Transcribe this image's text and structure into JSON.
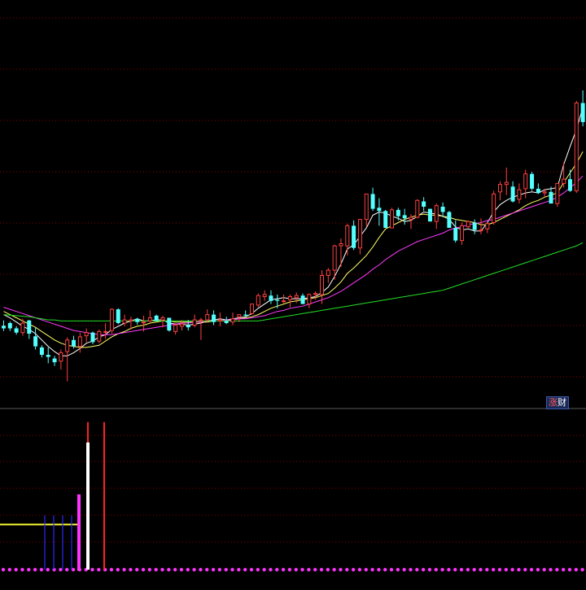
{
  "badge": {
    "text_a": "涨",
    "text_b": "财"
  },
  "colors": {
    "background": "#000000",
    "grid": "#8a0000",
    "panel_divider": "#5a5a5a",
    "up": "#ff4040",
    "down": "#54ffff",
    "ma5": "#ffffff",
    "ma10": "#ffff66",
    "ma20": "#ff3bff",
    "ma60": "#22e022",
    "indicator_line": "#ffff33",
    "indicator_dots": "#ff33ff",
    "indicator_blue": "#2a2aff",
    "indicator_red": "#ff2222",
    "indicator_magenta": "#ff33ff"
  },
  "chart_data": {
    "type": "candlestick",
    "price_range": [
      0,
      100
    ],
    "candles": [
      [
        61.5,
        62.5,
        60.5,
        61.0
      ],
      [
        62.0,
        62.3,
        60.5,
        61.0
      ],
      [
        61.0,
        61.4,
        59.8,
        60.2
      ],
      [
        60.2,
        62.8,
        59.6,
        62.0
      ],
      [
        62.5,
        62.6,
        59.0,
        60.0
      ],
      [
        59.5,
        61.2,
        57.0,
        57.6
      ],
      [
        57.4,
        57.8,
        55.5,
        56.0
      ],
      [
        56.0,
        57.4,
        54.4,
        55.6
      ],
      [
        55.3,
        55.8,
        53.9,
        54.6
      ],
      [
        54.8,
        57.0,
        53.2,
        56.4
      ],
      [
        56.6,
        59.3,
        51.0,
        58.8
      ],
      [
        58.8,
        59.6,
        57.2,
        57.6
      ],
      [
        57.6,
        60.2,
        56.4,
        59.4
      ],
      [
        59.6,
        61.0,
        58.4,
        60.2
      ],
      [
        60.2,
        60.4,
        58.0,
        58.4
      ],
      [
        58.6,
        60.8,
        58.2,
        60.4
      ],
      [
        60.4,
        62.0,
        59.0,
        60.4
      ],
      [
        60.6,
        64.8,
        60.0,
        64.6
      ],
      [
        64.6,
        64.8,
        61.8,
        62.0
      ],
      [
        62.0,
        63.6,
        61.4,
        62.6
      ],
      [
        62.4,
        63.2,
        60.8,
        62.6
      ],
      [
        62.8,
        63.0,
        61.7,
        62.2
      ],
      [
        62.2,
        63.4,
        60.4,
        62.2
      ],
      [
        62.4,
        64.4,
        62.0,
        63.0
      ],
      [
        63.4,
        63.6,
        62.4,
        62.4
      ],
      [
        62.6,
        63.4,
        61.2,
        63.0
      ],
      [
        63.0,
        63.0,
        60.4,
        60.6
      ],
      [
        60.4,
        62.0,
        59.8,
        61.6
      ],
      [
        61.4,
        62.6,
        60.6,
        61.8
      ],
      [
        61.6,
        62.6,
        60.6,
        61.2
      ],
      [
        61.6,
        63.6,
        61.2,
        62.6
      ],
      [
        62.6,
        63.0,
        58.8,
        62.6
      ],
      [
        62.6,
        64.6,
        62.2,
        63.6
      ],
      [
        63.6,
        64.4,
        61.6,
        62.2
      ],
      [
        62.4,
        64.0,
        61.4,
        62.6
      ],
      [
        62.4,
        63.2,
        61.8,
        62.0
      ],
      [
        62.2,
        64.0,
        61.6,
        62.8
      ],
      [
        63.2,
        63.6,
        62.2,
        63.6
      ],
      [
        63.6,
        64.4,
        63.2,
        63.4
      ],
      [
        63.8,
        65.6,
        63.6,
        65.6
      ],
      [
        65.4,
        67.6,
        65.0,
        67.2
      ],
      [
        67.0,
        68.2,
        66.2,
        67.4
      ],
      [
        67.2,
        68.2,
        65.6,
        66.2
      ],
      [
        66.4,
        67.4,
        64.8,
        66.2
      ],
      [
        66.2,
        67.4,
        65.8,
        66.2
      ],
      [
        66.4,
        67.4,
        65.0,
        67.0
      ],
      [
        66.8,
        67.8,
        65.8,
        67.2
      ],
      [
        67.2,
        67.6,
        65.6,
        65.6
      ],
      [
        65.6,
        67.6,
        64.8,
        67.4
      ],
      [
        67.4,
        68.0,
        66.4,
        67.6
      ],
      [
        67.4,
        72.0,
        65.6,
        71.0
      ],
      [
        71.0,
        72.4,
        69.6,
        72.0
      ],
      [
        72.0,
        76.8,
        70.2,
        76.6
      ],
      [
        76.6,
        78.0,
        72.6,
        77.0
      ],
      [
        76.6,
        80.8,
        74.8,
        80.4
      ],
      [
        80.4,
        81.4,
        75.8,
        76.2
      ],
      [
        76.2,
        81.6,
        75.0,
        81.6
      ],
      [
        81.6,
        86.4,
        80.2,
        86.4
      ],
      [
        86.4,
        87.6,
        83.2,
        83.6
      ],
      [
        83.8,
        85.6,
        80.4,
        83.2
      ],
      [
        83.2,
        83.4,
        80.0,
        80.0
      ],
      [
        80.0,
        83.8,
        80.0,
        83.4
      ],
      [
        83.4,
        83.8,
        81.4,
        82.2
      ],
      [
        82.4,
        83.6,
        80.6,
        81.8
      ],
      [
        81.6,
        82.6,
        79.8,
        82.0
      ],
      [
        82.0,
        85.4,
        81.8,
        85.2
      ],
      [
        85.0,
        85.8,
        83.2,
        84.0
      ],
      [
        83.6,
        83.6,
        81.2,
        81.2
      ],
      [
        81.2,
        84.6,
        79.8,
        84.2
      ],
      [
        84.0,
        84.8,
        82.0,
        83.0
      ],
      [
        83.0,
        83.2,
        80.2,
        80.0
      ],
      [
        80.0,
        81.4,
        77.2,
        77.6
      ],
      [
        77.6,
        81.0,
        76.8,
        80.4
      ],
      [
        80.2,
        81.4,
        80.0,
        81.2
      ],
      [
        81.0,
        81.6,
        78.8,
        79.6
      ],
      [
        79.6,
        81.8,
        78.8,
        79.6
      ],
      [
        79.8,
        81.0,
        79.0,
        80.8
      ],
      [
        81.0,
        87.0,
        80.6,
        86.4
      ],
      [
        86.8,
        88.8,
        85.2,
        88.2
      ],
      [
        88.2,
        91.4,
        86.2,
        88.6
      ],
      [
        87.8,
        88.8,
        84.8,
        85.0
      ],
      [
        85.4,
        88.4,
        84.6,
        87.2
      ],
      [
        87.4,
        91.0,
        85.6,
        90.2
      ],
      [
        90.2,
        90.6,
        87.0,
        87.4
      ],
      [
        87.4,
        88.4,
        86.4,
        86.6
      ],
      [
        86.6,
        87.4,
        85.8,
        86.8
      ],
      [
        86.8,
        87.8,
        84.8,
        84.6
      ],
      [
        84.6,
        88.4,
        84.0,
        88.4
      ],
      [
        88.4,
        92.4,
        87.6,
        89.2
      ],
      [
        89.2,
        91.0,
        86.8,
        87.0
      ],
      [
        87.0,
        104.0,
        86.6,
        103.6
      ],
      [
        103.6,
        106.0,
        99.2,
        100.0
      ],
      [
        100.0,
        107.2,
        98.6,
        104.2
      ],
      [
        104.2,
        110.0,
        103.2,
        109.8
      ]
    ],
    "ma_series": [
      {
        "name": "MA5",
        "values": [
          63.6,
          63.0,
          62.2,
          61.4,
          60.8,
          60.0,
          58.8,
          57.6,
          56.6,
          55.8,
          55.8,
          56.4,
          57.2,
          58.2,
          58.6,
          59.4,
          59.8,
          60.8,
          61.4,
          62.0,
          62.4,
          62.8,
          62.4,
          62.4,
          62.6,
          62.6,
          62.0,
          61.8,
          61.8,
          61.6,
          61.8,
          62.0,
          62.4,
          62.6,
          62.8,
          62.6,
          62.8,
          63.0,
          63.2,
          63.8,
          64.8,
          65.6,
          66.4,
          66.6,
          66.8,
          66.6,
          66.6,
          66.6,
          66.8,
          67.0,
          67.8,
          68.8,
          70.8,
          73.2,
          76.0,
          76.8,
          78.4,
          80.0,
          82.4,
          83.0,
          82.8,
          82.2,
          81.8,
          81.2,
          81.4,
          82.2,
          83.0,
          82.8,
          82.6,
          82.2,
          81.6,
          80.2,
          79.6,
          79.8,
          79.4,
          79.4,
          81.0,
          83.0,
          84.4,
          85.2,
          85.8,
          86.2,
          86.6,
          86.8,
          86.6,
          87.2,
          87.4,
          87.6,
          92.0,
          95.4,
          98.6,
          102.8
        ]
      },
      {
        "name": "MA10",
        "values": [
          64.2,
          63.6,
          63.0,
          62.4,
          61.8,
          61.2,
          60.4,
          59.6,
          58.8,
          58.2,
          57.8,
          57.6,
          57.4,
          57.4,
          57.6,
          57.8,
          58.6,
          59.4,
          60.0,
          60.4,
          61.0,
          61.4,
          61.6,
          62.0,
          62.2,
          62.4,
          62.4,
          62.2,
          62.2,
          62.2,
          62.2,
          62.2,
          62.2,
          62.4,
          62.4,
          62.4,
          62.6,
          62.8,
          63.0,
          63.2,
          63.6,
          64.2,
          64.8,
          65.2,
          65.6,
          66.0,
          66.2,
          66.4,
          66.6,
          66.8,
          67.2,
          67.6,
          68.6,
          69.8,
          71.4,
          72.4,
          73.6,
          74.8,
          76.4,
          78.2,
          79.8,
          80.4,
          81.0,
          81.6,
          82.0,
          82.4,
          82.6,
          82.4,
          82.4,
          82.2,
          82.0,
          81.6,
          81.4,
          81.2,
          81.0,
          80.6,
          80.6,
          81.0,
          81.6,
          82.2,
          82.8,
          83.4,
          84.2,
          84.8,
          85.2,
          85.8,
          86.2,
          86.6,
          88.6,
          90.4,
          92.2,
          94.4
        ]
      },
      {
        "name": "MA20",
        "values": [
          65.0,
          64.6,
          64.2,
          63.8,
          63.4,
          63.0,
          62.6,
          62.2,
          61.8,
          61.4,
          61.0,
          60.6,
          60.4,
          60.2,
          60.0,
          59.8,
          59.8,
          59.8,
          60.0,
          60.2,
          60.4,
          60.6,
          60.8,
          61.0,
          61.2,
          61.4,
          61.6,
          61.8,
          62.0,
          62.0,
          62.2,
          62.2,
          62.4,
          62.4,
          62.4,
          62.6,
          62.6,
          62.8,
          62.8,
          63.0,
          63.2,
          63.4,
          63.8,
          64.2,
          64.4,
          64.8,
          65.0,
          65.2,
          65.6,
          66.0,
          66.4,
          66.8,
          67.4,
          68.0,
          68.8,
          69.6,
          70.4,
          71.2,
          72.2,
          73.0,
          74.0,
          74.8,
          75.6,
          76.2,
          76.8,
          77.4,
          77.8,
          78.2,
          78.6,
          79.0,
          79.6,
          80.0,
          80.2,
          80.6,
          80.8,
          81.0,
          81.4,
          81.6,
          82.0,
          82.4,
          82.8,
          83.2,
          83.6,
          84.0,
          84.4,
          84.8,
          85.2,
          85.8,
          86.6,
          87.6,
          88.6,
          89.8
        ]
      },
      {
        "name": "MA60",
        "values": [
          63.6,
          63.5,
          63.4,
          63.3,
          63.2,
          63.0,
          62.8,
          62.6,
          62.6,
          62.4,
          62.4,
          62.4,
          62.4,
          62.4,
          62.4,
          62.4,
          62.4,
          62.4,
          62.4,
          62.4,
          62.4,
          62.4,
          62.4,
          62.4,
          62.4,
          62.4,
          62.4,
          62.4,
          62.4,
          62.4,
          62.4,
          62.4,
          62.4,
          62.4,
          62.4,
          62.4,
          62.4,
          62.4,
          62.4,
          62.4,
          62.4,
          62.6,
          62.8,
          63.0,
          63.2,
          63.4,
          63.6,
          63.8,
          64.0,
          64.2,
          64.4,
          64.6,
          64.8,
          65.0,
          65.2,
          65.4,
          65.6,
          65.8,
          66.0,
          66.2,
          66.4,
          66.6,
          66.8,
          67.0,
          67.2,
          67.4,
          67.6,
          67.8,
          68.0,
          68.2,
          68.6,
          69.0,
          69.4,
          69.8,
          70.2,
          70.6,
          71.0,
          71.4,
          71.8,
          72.2,
          72.6,
          73.0,
          73.4,
          73.8,
          74.2,
          74.6,
          75.0,
          75.4,
          75.8,
          76.2,
          76.6,
          77.2
        ]
      }
    ],
    "indicator": {
      "value_range": [
        0,
        100
      ],
      "yellow_line": [
        30,
        30,
        30,
        30,
        30,
        30,
        30,
        30,
        30,
        30,
        30,
        30,
        30,
        30,
        30,
        30,
        30,
        30,
        30,
        30,
        30,
        30,
        30,
        0,
        0
      ],
      "dots": 92,
      "blue_bars": [
        {
          "index": 9,
          "value": 36
        },
        {
          "index": 11,
          "value": 36
        },
        {
          "index": 13,
          "value": 36
        },
        {
          "index": 15,
          "value": 36
        }
      ],
      "magenta_bars": [
        {
          "index": 17,
          "value": 50
        }
      ],
      "red_bars": [
        {
          "index": 18,
          "value": 98
        },
        {
          "index": 21,
          "value": 98
        }
      ]
    }
  }
}
